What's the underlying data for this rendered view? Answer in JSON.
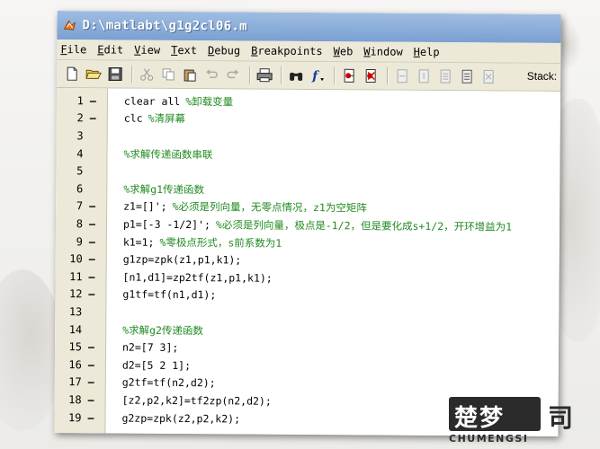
{
  "window": {
    "title": "D:\\matlabt\\g1g2cl06.m"
  },
  "menu": [
    {
      "label": "File",
      "key": "F",
      "rest": "ile"
    },
    {
      "label": "Edit",
      "key": "E",
      "rest": "dit"
    },
    {
      "label": "View",
      "key": "V",
      "rest": "iew"
    },
    {
      "label": "Text",
      "key": "T",
      "rest": "ext"
    },
    {
      "label": "Debug",
      "key": "D",
      "rest": "ebug"
    },
    {
      "label": "Breakpoints",
      "key": "B",
      "rest": "reakpoints"
    },
    {
      "label": "Web",
      "key": "W",
      "rest": "eb"
    },
    {
      "label": "Window",
      "key": "W",
      "rest": "indow"
    },
    {
      "label": "Help",
      "key": "H",
      "rest": "elp"
    }
  ],
  "toolbar": {
    "stack_label": "Stack:"
  },
  "editor": {
    "lines": [
      {
        "n": "1",
        "dash": "—",
        "code": "clear all",
        "comment": "%卸载变量"
      },
      {
        "n": "2",
        "dash": "—",
        "code": "clc",
        "comment": "%清屏幕"
      },
      {
        "n": "3",
        "dash": "",
        "code": "",
        "comment": ""
      },
      {
        "n": "4",
        "dash": "",
        "code": "",
        "comment": "%求解传递函数串联"
      },
      {
        "n": "5",
        "dash": "",
        "code": "",
        "comment": ""
      },
      {
        "n": "6",
        "dash": "",
        "code": "",
        "comment": "%求解g1传递函数"
      },
      {
        "n": "7",
        "dash": "—",
        "code": "z1=[]';",
        "comment": "%必须是列向量，无零点情况，z1为空矩阵"
      },
      {
        "n": "8",
        "dash": "—",
        "code": "p1=[-3 -1/2]';",
        "comment": "%必须是列向量，极点是-1/2，但是要化成s+1/2，开环增益为1"
      },
      {
        "n": "9",
        "dash": "—",
        "code": "k1=1;",
        "comment": "%零极点形式，s前系数为1"
      },
      {
        "n": "10",
        "dash": "—",
        "code": "g1zp=zpk(z1,p1,k1);",
        "comment": ""
      },
      {
        "n": "11",
        "dash": "—",
        "code": "[n1,d1]=zp2tf(z1,p1,k1);",
        "comment": ""
      },
      {
        "n": "12",
        "dash": "—",
        "code": "g1tf=tf(n1,d1);",
        "comment": ""
      },
      {
        "n": "13",
        "dash": "",
        "code": "",
        "comment": ""
      },
      {
        "n": "14",
        "dash": "",
        "code": "",
        "comment": "%求解g2传递函数"
      },
      {
        "n": "15",
        "dash": "—",
        "code": "n2=[7 3];",
        "comment": ""
      },
      {
        "n": "16",
        "dash": "—",
        "code": "d2=[5 2 1];",
        "comment": ""
      },
      {
        "n": "17",
        "dash": "—",
        "code": "g2tf=tf(n2,d2);",
        "comment": ""
      },
      {
        "n": "18",
        "dash": "—",
        "code": "[z2,p2,k2]=tf2zp(n2,d2);",
        "comment": ""
      },
      {
        "n": "19",
        "dash": "—",
        "code": "g2zp=zpk(z2,p2,k2);",
        "comment": ""
      }
    ]
  },
  "watermark": {
    "glyphs": "楚梦",
    "tail": "司",
    "text": "CHUMENGSI"
  },
  "colors": {
    "comment": "#228b22",
    "titlebar": "#7aa0d2",
    "chrome": "#ece9d8"
  }
}
